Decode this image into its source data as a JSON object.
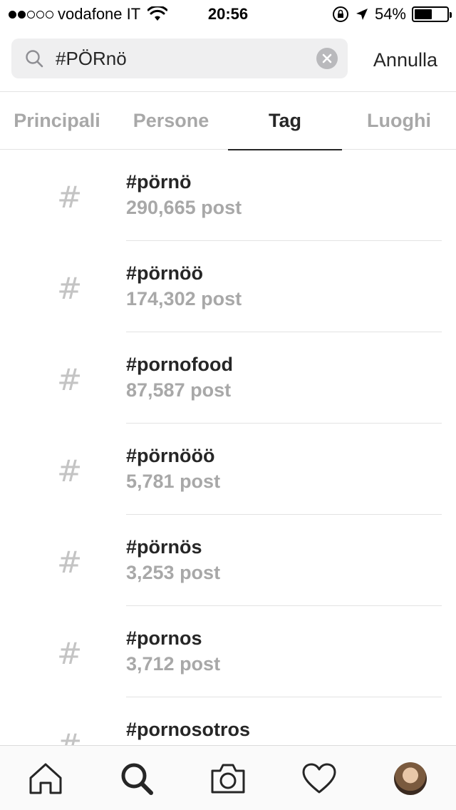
{
  "status_bar": {
    "carrier": "vodafone IT",
    "time": "20:56",
    "battery_percent": "54%",
    "battery_level": 0.54,
    "signal_bars_filled": 2,
    "signal_bars_total": 5
  },
  "search": {
    "query": "#PÖRnö",
    "cancel_label": "Annulla"
  },
  "tabs": [
    {
      "label": "Principali",
      "active": false
    },
    {
      "label": "Persone",
      "active": false
    },
    {
      "label": "Tag",
      "active": true
    },
    {
      "label": "Luoghi",
      "active": false
    }
  ],
  "results": [
    {
      "icon": "#",
      "tag": "#pörnö",
      "count": "290,665 post"
    },
    {
      "icon": "#",
      "tag": "#pörnöö",
      "count": "174,302 post"
    },
    {
      "icon": "#",
      "tag": "#pornofood",
      "count": "87,587 post"
    },
    {
      "icon": "#",
      "tag": "#pörnööö",
      "count": "5,781 post"
    },
    {
      "icon": "#",
      "tag": "#pörnös",
      "count": "3,253 post"
    },
    {
      "icon": "#",
      "tag": "#pornos",
      "count": "3,712 post"
    },
    {
      "icon": "#",
      "tag": "#pornosotros",
      "count": ""
    }
  ],
  "bottom_nav": [
    {
      "icon": "home-icon"
    },
    {
      "icon": "search-icon",
      "active": true
    },
    {
      "icon": "camera-icon"
    },
    {
      "icon": "heart-icon"
    },
    {
      "icon": "profile-avatar"
    }
  ],
  "colors": {
    "primary_text": "#262626",
    "secondary_text": "#a8a8a8",
    "search_bg": "#efeff0",
    "divider": "#e3e3e3"
  }
}
